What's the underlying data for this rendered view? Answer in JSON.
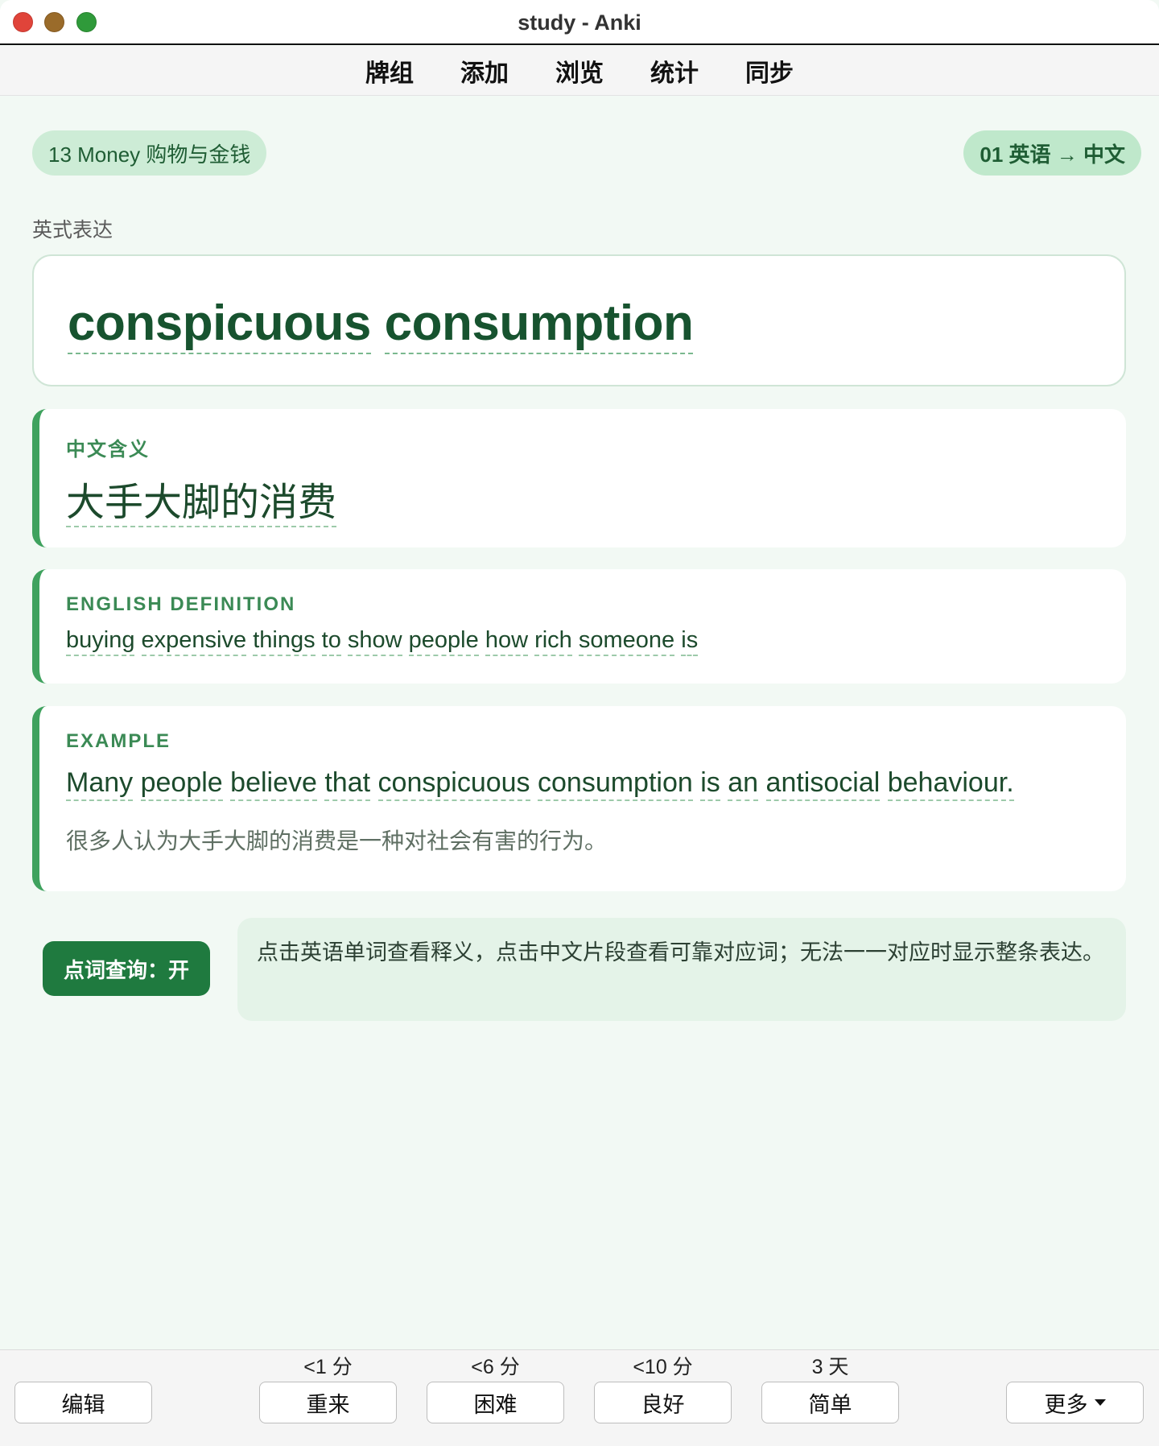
{
  "window": {
    "title": "study - Anki"
  },
  "toolbar": {
    "items": [
      "牌组",
      "添加",
      "浏览",
      "统计",
      "同步"
    ]
  },
  "deck_tag": "13 Money 购物与金钱",
  "card_type_tag": "01 英语 → 中文",
  "section_label": "英式表达",
  "expression": {
    "words": [
      "conspicuous",
      "consumption"
    ]
  },
  "meaning": {
    "label": "中文含义",
    "text": "大手大脚的消费"
  },
  "definition": {
    "label": "ENGLISH DEFINITION",
    "words": [
      "buying",
      "expensive",
      "things",
      "to",
      "show",
      "people",
      "how",
      "rich",
      "someone",
      "is"
    ]
  },
  "example": {
    "label": "EXAMPLE",
    "words": [
      "Many",
      "people",
      "believe",
      "that",
      "conspicuous",
      "consumption",
      "is",
      "an",
      "antisocial",
      "behaviour."
    ],
    "translation": "很多人认为大手大脚的消费是一种对社会有害的行为。"
  },
  "lookup_toggle": "点词查询：开",
  "hint": "点击英语单词查看释义，点击中文片段查看可靠对应词；无法一一对应时显示整条表达。",
  "bottom": {
    "edit": "编辑",
    "more": "更多",
    "answers": [
      {
        "interval": "<1 分",
        "label": "重来"
      },
      {
        "interval": "<6 分",
        "label": "困难"
      },
      {
        "interval": "<10 分",
        "label": "良好"
      },
      {
        "interval": "3 天",
        "label": "简单"
      }
    ]
  },
  "colors": {
    "accent": "#1f7a3f",
    "card_border": "#3fa25e",
    "background": "#f2f9f4"
  }
}
